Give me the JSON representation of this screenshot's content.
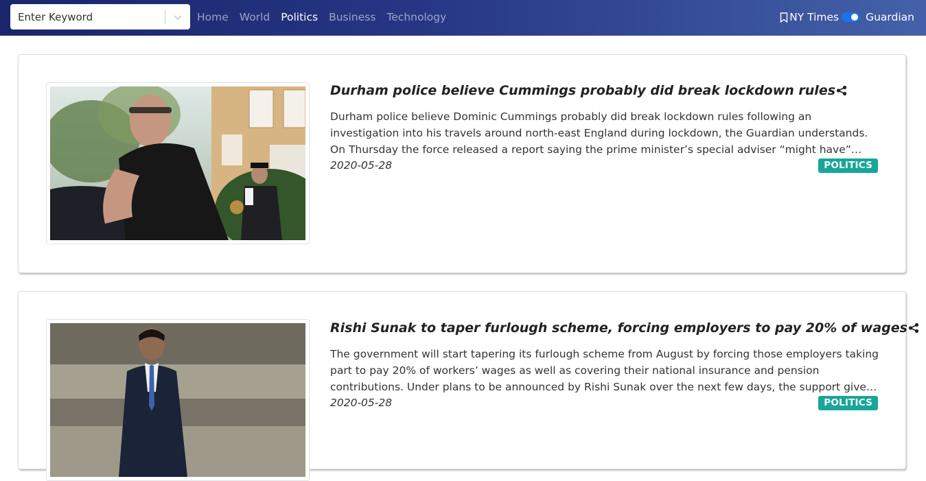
{
  "search": {
    "placeholder": "Enter Keyword"
  },
  "nav": {
    "links": [
      "Home",
      "World",
      "Politics",
      "Business",
      "Technology"
    ],
    "active": "Politics"
  },
  "source_toggle": {
    "left_label": "NY Times",
    "right_label": "Guardian",
    "selected": "Guardian",
    "accent_color": "#1a73e8"
  },
  "articles": [
    {
      "title": "Durham police believe Cummings probably did break lockdown rules",
      "description": "Durham police believe Dominic Cummings probably did break lockdown rules following an investigation into his travels around north-east England during lockdown, the Guardian understands. On Thursday the force released a report saying the prime minister’s special adviser “might have” breached health protection regulations when he…",
      "date": "2020-05-28",
      "section": "POLITICS",
      "image_alt": "Dominic Cummings walking outside, police officer behind"
    },
    {
      "title": "Rishi Sunak to taper furlough scheme, forcing employers to pay 20% of wages",
      "description": "The government will start tapering its furlough scheme from August by forcing those employers taking part to pay 20% of workers’ wages as well as covering their national insurance and pension contributions. Under plans to be announced by Rishi Sunak over the next few days, the support given by the furlough scheme will be cut bac…",
      "date": "2020-05-28",
      "section": "POLITICS",
      "image_alt": "Rishi Sunak in a dark suit walking outdoors"
    }
  ],
  "colors": {
    "badge": "#17a699",
    "nav_gradient_start": "#1a2669",
    "nav_gradient_end": "#4461a9"
  }
}
